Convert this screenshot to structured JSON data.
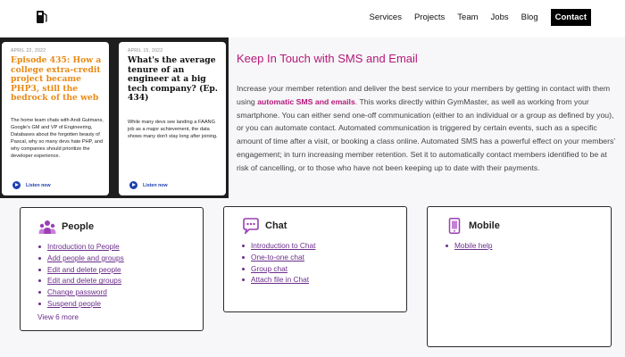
{
  "header": {
    "nav": [
      "Services",
      "Projects",
      "Team",
      "Jobs",
      "Blog"
    ],
    "contact_label": "Contact"
  },
  "cards": [
    {
      "date": "APRIL 22, 2022",
      "title": "Episode 435: How a college extra-credit project became PHP3, still the bedrock of the web",
      "desc": "The home team chats with Andi Gutmans, Google's GM and VP of Engineering, Databases about the forgotten beauty of Pascal, why so many devs hate PHP, and why companies should prioritize the developer experience.",
      "listen": "Listen now"
    },
    {
      "date": "APRIL 15, 2022",
      "title": "What's the average tenure of an engineer at a big tech company? (Ep. 434)",
      "desc": "While many devs see landing a FAANG job as a major achievement, the data shows many don't stay long after joining.",
      "listen": "Listen now"
    }
  ],
  "main": {
    "heading": "Keep In Touch with SMS and Email",
    "para_1": "Increase your member retention and deliver the best service to your members by getting in contact with them using ",
    "para_bold": "automatic SMS and emails",
    "para_2": ". This works directly within GymMaster, as well as working from your smartphone. You can either send one-off communication (either to an individual or a group as defined by you), or you can automate contact. Automated communication is triggered by certain events, such as a specific amount of time after a visit, or booking a class online. Automated SMS has a powerful effect on your members' engagement; in turn increasing member retention. Set it to automatically contact members identified to be at risk of cancelling, or to those who have not been keeping up to date with their payments."
  },
  "boxes": {
    "people": {
      "title": "People",
      "links": [
        "Introduction to People",
        "Add people and groups",
        "Edit and delete people",
        "Edit and delete groups",
        "Change password",
        "Suspend people"
      ],
      "more": "View 6 more"
    },
    "chat": {
      "title": "Chat",
      "links": [
        "Introduction to Chat",
        "One-to-one chat",
        "Group chat",
        "Attach file in Chat"
      ]
    },
    "mobile": {
      "title": "Mobile",
      "links": [
        "Mobile help"
      ]
    }
  },
  "colors": {
    "accent": "#b4197a",
    "link": "#6a2d8a",
    "orange": "#e88a16",
    "play": "#1c3fb0"
  },
  "icons": {
    "logo": "fuel-pump-icon",
    "people": "people-icon",
    "chat": "chat-bubble-icon",
    "mobile": "mobile-phone-icon",
    "play": "play-icon"
  }
}
